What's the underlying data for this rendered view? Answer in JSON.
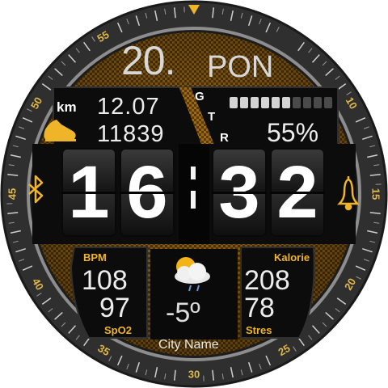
{
  "date": {
    "day_number": "20.",
    "weekday": "PON"
  },
  "activity": {
    "distance_unit": "km",
    "distance": "12.07",
    "steps": "11839"
  },
  "gtr_letters": {
    "g": "G",
    "t": "T",
    "r": "R"
  },
  "battery": {
    "percent_text": "55%",
    "level": 0.55,
    "segments": 10
  },
  "time": {
    "h1": "1",
    "h2": "6",
    "m1": "3",
    "m2": "2"
  },
  "heart": {
    "label": "BPM",
    "value": "108"
  },
  "spo2": {
    "label": "SpO2",
    "value": "97"
  },
  "calories": {
    "label": "Kalorie",
    "value": "208"
  },
  "stress": {
    "label": "Stres",
    "value": "78"
  },
  "weather": {
    "temperature": "-5º",
    "city": "City Name",
    "icon": "partly-cloudy-icon"
  },
  "bezel": {
    "numbers": [
      "10",
      "15",
      "20",
      "25",
      "30",
      "35",
      "40",
      "45",
      "50",
      "55"
    ]
  },
  "icons": [
    "running-shoe-icon",
    "bluetooth-icon",
    "bell-icon"
  ],
  "colors": {
    "accent": "#f0b428",
    "bezel": "#3a3a3a",
    "panel": "#0c0c0c"
  }
}
